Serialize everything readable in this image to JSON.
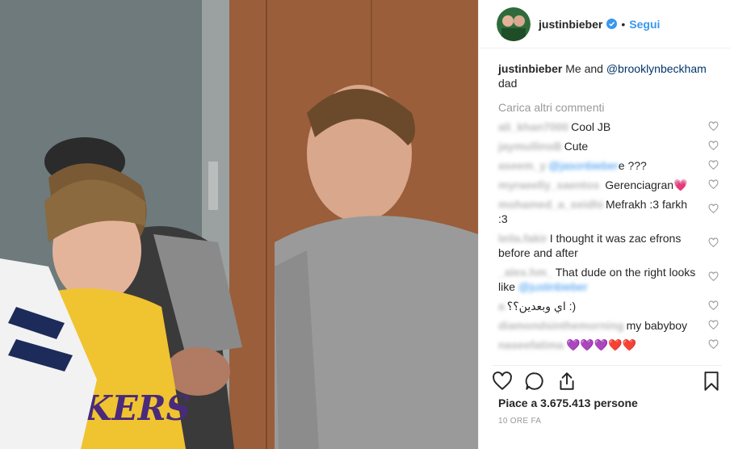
{
  "header": {
    "username": "justinbieber",
    "dot": "•",
    "follow_label": "Segui"
  },
  "caption": {
    "username": "justinbieber",
    "text_before": "Me and",
    "mention": "@brooklynbeckham",
    "text_after": "dad"
  },
  "load_more": "Carica altri commenti",
  "comments": [
    {
      "user": "ali_khan7000",
      "text": "Cool JB"
    },
    {
      "user": "jaymullinsB",
      "text": "Cute"
    },
    {
      "user": "aseem_y",
      "mention": "@jasonbieber",
      "text": "e ???"
    },
    {
      "user": "myraeelly_saentos",
      "user_visible": "ntos",
      "text": "Gerenciagran💗"
    },
    {
      "user": "mohamed_a_seidhi",
      "text": "Mefrakh :3 farkh :3"
    },
    {
      "user": "leila.fakir",
      "user_visible": "d",
      "text": "I thought it was zac efrons before and after"
    },
    {
      "user": "_alex.hm_",
      "text": "That dude on the right looks like",
      "mention": "@justinbieber"
    },
    {
      "user": "a",
      "user_visible": "a",
      "text": "اي وبعدين؟؟ :)"
    },
    {
      "user": "diamondsinthemorning",
      "text": "my babyboy"
    },
    {
      "user": "naseefatima",
      "text": "💜💜💜❤️❤️"
    }
  ],
  "likes": "Piace a 3.675.413 persone",
  "time": "10 ORE FA",
  "icons": {
    "like": "heart-outline-icon",
    "comment": "speech-bubble-icon",
    "share": "share-upload-icon",
    "save": "bookmark-icon",
    "verified": "verified-badge-icon"
  },
  "colors": {
    "follow": "#3897f0",
    "verified": "#3897f0",
    "muted": "#999999",
    "text": "#262626"
  }
}
